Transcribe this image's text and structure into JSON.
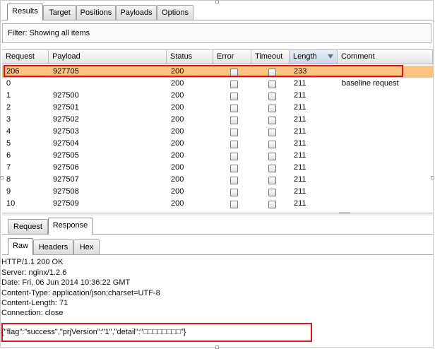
{
  "tabs": [
    "Results",
    "Target",
    "Positions",
    "Payloads",
    "Options"
  ],
  "filter_text": "Filter:  Showing all items",
  "columns": [
    "Request",
    "Payload",
    "Status",
    "Error",
    "Timeout",
    "Length",
    "Comment"
  ],
  "sorted_column": "Length",
  "rows": [
    {
      "request": "206",
      "payload": "927705",
      "status": "200",
      "length": "233",
      "comment": "",
      "selected": true
    },
    {
      "request": "0",
      "payload": "",
      "status": "200",
      "length": "211",
      "comment": "baseline request"
    },
    {
      "request": "1",
      "payload": "927500",
      "status": "200",
      "length": "211",
      "comment": ""
    },
    {
      "request": "2",
      "payload": "927501",
      "status": "200",
      "length": "211",
      "comment": ""
    },
    {
      "request": "3",
      "payload": "927502",
      "status": "200",
      "length": "211",
      "comment": ""
    },
    {
      "request": "4",
      "payload": "927503",
      "status": "200",
      "length": "211",
      "comment": ""
    },
    {
      "request": "5",
      "payload": "927504",
      "status": "200",
      "length": "211",
      "comment": ""
    },
    {
      "request": "6",
      "payload": "927505",
      "status": "200",
      "length": "211",
      "comment": ""
    },
    {
      "request": "7",
      "payload": "927506",
      "status": "200",
      "length": "211",
      "comment": ""
    },
    {
      "request": "8",
      "payload": "927507",
      "status": "200",
      "length": "211",
      "comment": ""
    },
    {
      "request": "9",
      "payload": "927508",
      "status": "200",
      "length": "211",
      "comment": ""
    },
    {
      "request": "10",
      "payload": "927509",
      "status": "200",
      "length": "211",
      "comment": ""
    }
  ],
  "message_tabs": [
    "Request",
    "Response"
  ],
  "message_tab_active": "Response",
  "view_tabs": [
    "Raw",
    "Headers",
    "Hex"
  ],
  "view_tab_active": "Raw",
  "response_lines": [
    "HTTP/1.1 200 OK",
    "Server: nginx/1.2.6",
    "Date: Fri, 06 Jun 2014 10:36:22 GMT",
    "Content-Type: application/json;charset=UTF-8",
    "Content-Length: 71",
    "Connection: close"
  ],
  "response_body": "{\"flag\":\"success\",\"prjVersion\":\"1\",\"detail\":\"□□□□□□□□\"}",
  "colors": {
    "selected_row": "#fec37e",
    "highlight_box": "#e1141d"
  }
}
